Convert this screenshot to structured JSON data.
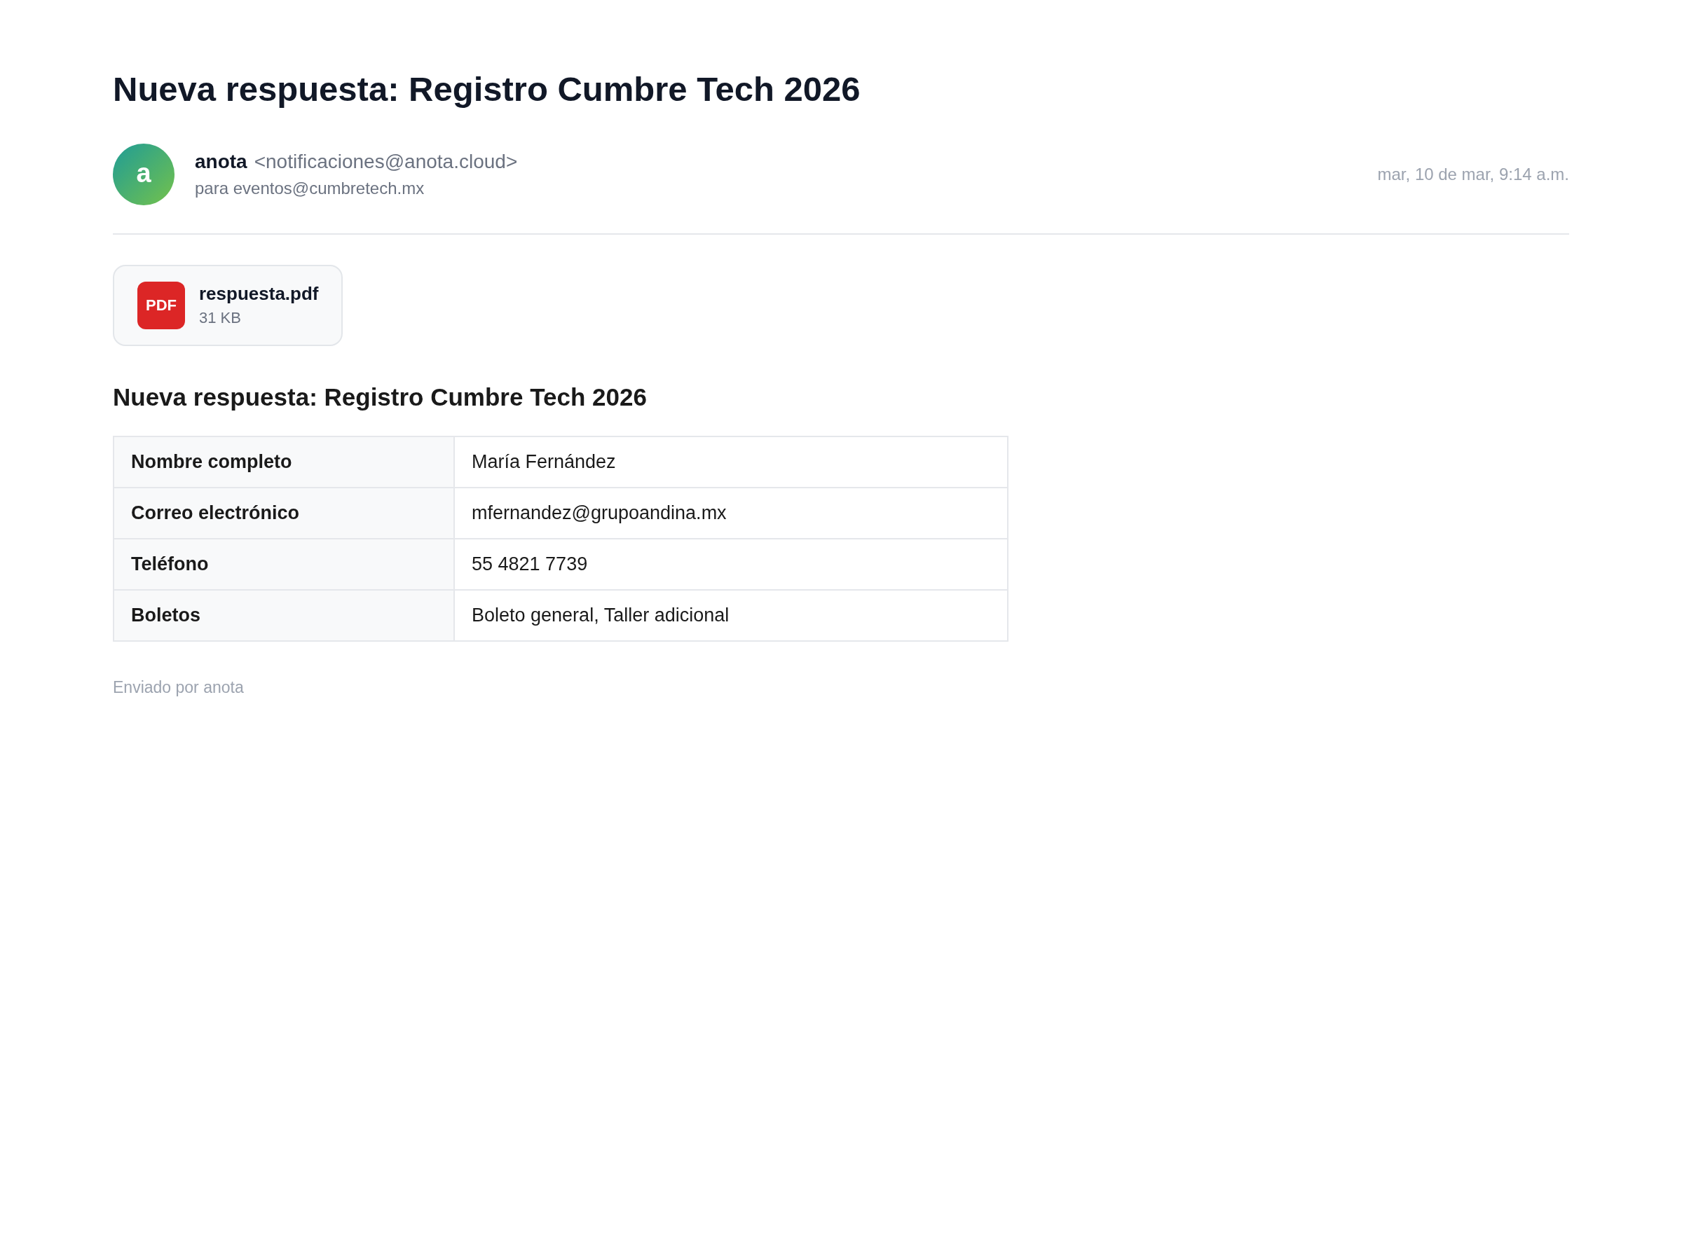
{
  "email": {
    "subject": "Nueva respuesta: Registro Cumbre Tech 2026",
    "sender": {
      "avatar_letter": "a",
      "name": "anota",
      "address": "<notificaciones@anota.cloud>"
    },
    "recipient": "para eventos@cumbretech.mx",
    "date": "mar, 10 de mar, 9:14 a.m."
  },
  "attachments": [
    {
      "type_label": "PDF",
      "filename": "respuesta.pdf",
      "size": "31 KB"
    }
  ],
  "body": {
    "heading": "Nueva respuesta: Registro Cumbre Tech 2026",
    "table": {
      "rows": [
        {
          "label": "Nombre completo",
          "value": "María Fernández"
        },
        {
          "label": "Correo electrónico",
          "value": "mfernandez@grupoandina.mx"
        },
        {
          "label": "Teléfono",
          "value": "55 4821 7739"
        },
        {
          "label": "Boletos",
          "value": "Boleto general, Taller adicional"
        }
      ]
    },
    "footer": "Enviado por anota"
  }
}
